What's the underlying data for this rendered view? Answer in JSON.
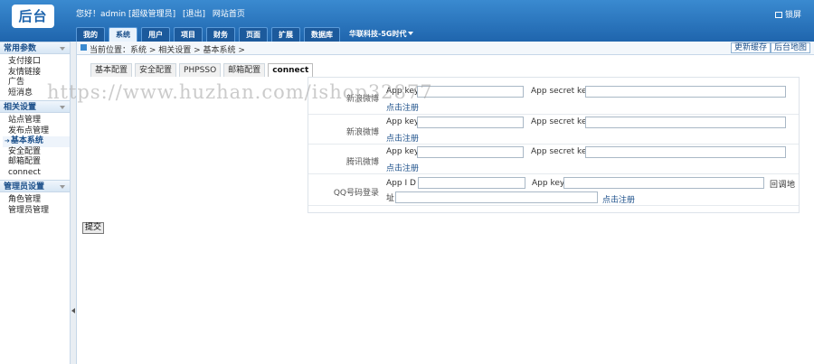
{
  "header": {
    "logo_text": "后台",
    "greeting": "您好！admin [超级管理员]",
    "logout": "[退出]",
    "site_home": "网站首页",
    "lock_label": "锁屏",
    "nav": [
      "我的",
      "系统",
      "用户",
      "项目",
      "财务",
      "页面",
      "扩展",
      "数据库"
    ],
    "nav_active_index": 1,
    "site_select": "华联科技-5G时代"
  },
  "sidebar": {
    "sections": [
      {
        "title": "常用参数",
        "items": [
          "支付接口",
          "友情链接",
          "广告",
          "短消息"
        ]
      },
      {
        "title": "相关设置",
        "items": [
          "站点管理",
          "发布点管理",
          "基本系统",
          "安全配置",
          "邮箱配置",
          "connect"
        ]
      },
      {
        "title": "管理员设置",
        "items": [
          "角色管理",
          "管理员管理"
        ]
      }
    ],
    "active_item": "基本系统"
  },
  "breadcrumb": {
    "text": "当前位置：系统 > 相关设置 > 基本系统 >",
    "update_cache": "更新缓存",
    "site_map": "后台地图"
  },
  "tabs": [
    "基本配置",
    "安全配置",
    "PHPSSO",
    "邮箱配置",
    "connect"
  ],
  "tabs_active_index": 4,
  "form": {
    "sina": {
      "label": "新浪微博",
      "key_label": "App key",
      "secret_label": "App secret key",
      "register": "点击注册"
    },
    "qq_weibo": {
      "label": "腾讯微博",
      "key_label": "App key",
      "secret_label": "App secret key",
      "register": "点击注册"
    },
    "qq_login": {
      "label": "QQ号码登录",
      "id_label": "App I D",
      "key_label": "App key",
      "callback_label": "回调地址",
      "register": "点击注册"
    },
    "row1": {
      "label": "新浪微博",
      "key_label": "App key",
      "secret_label": "App secret key",
      "register": "点击注册"
    }
  },
  "submit_label": "提交",
  "watermark": "https://www.huzhan.com/ishop32877",
  "colors": {
    "header": "#2a75c0",
    "accent": "#1b4f8a"
  }
}
